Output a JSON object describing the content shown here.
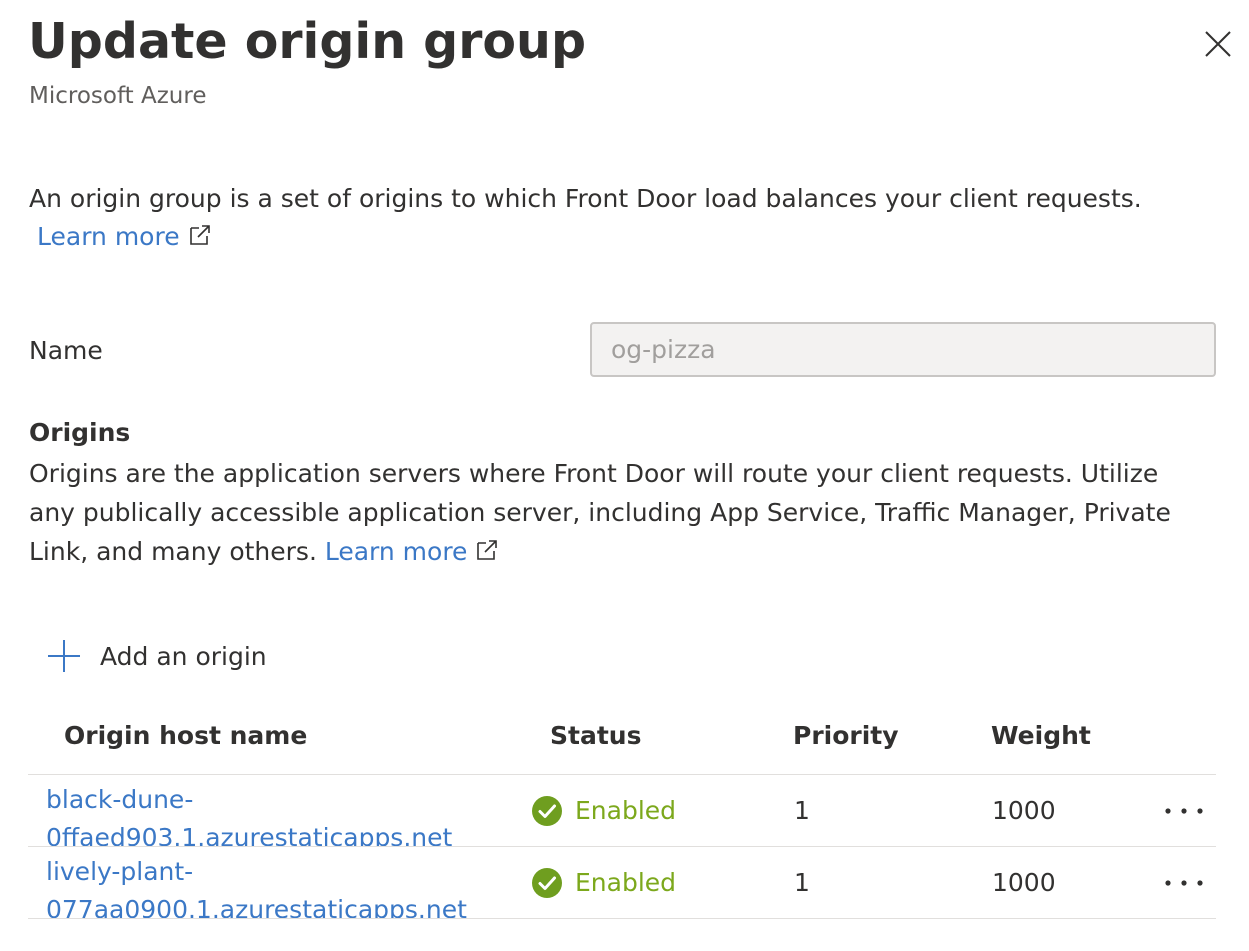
{
  "header": {
    "title": "Update origin group",
    "subtitle": "Microsoft Azure"
  },
  "intro": {
    "text": "An origin group is a set of origins to which Front Door load balances your client requests.",
    "learn_more": "Learn more"
  },
  "name_field": {
    "label": "Name",
    "value": "og-pizza"
  },
  "origins": {
    "title": "Origins",
    "description_lines": [
      "Origins are the application servers where Front Door will route your client requests. Utilize",
      "any publically accessible application server, including App Service, Traffic Manager, Private",
      "Link, and many others."
    ],
    "learn_more": "Learn more",
    "add_label": "Add an origin",
    "columns": [
      "Origin host name",
      "Status",
      "Priority",
      "Weight"
    ],
    "rows": [
      {
        "host_line1": "black-dune-",
        "host_line2": "0ffaed903.1.azurestaticapps.net",
        "status": "Enabled",
        "priority": "1",
        "weight": "1000"
      },
      {
        "host_line1": "lively-plant-",
        "host_line2": "077aa0900.1.azurestaticapps.net",
        "status": "Enabled",
        "priority": "1",
        "weight": "1000"
      }
    ]
  },
  "colors": {
    "link": "#3b78c6",
    "status_enabled": "#7ca81c",
    "text": "#323130"
  },
  "icons": {
    "close": "close-icon",
    "external_link": "external-link-icon",
    "add": "plus-icon",
    "status": "check-circle-icon",
    "more": "more-horizontal-icon"
  }
}
